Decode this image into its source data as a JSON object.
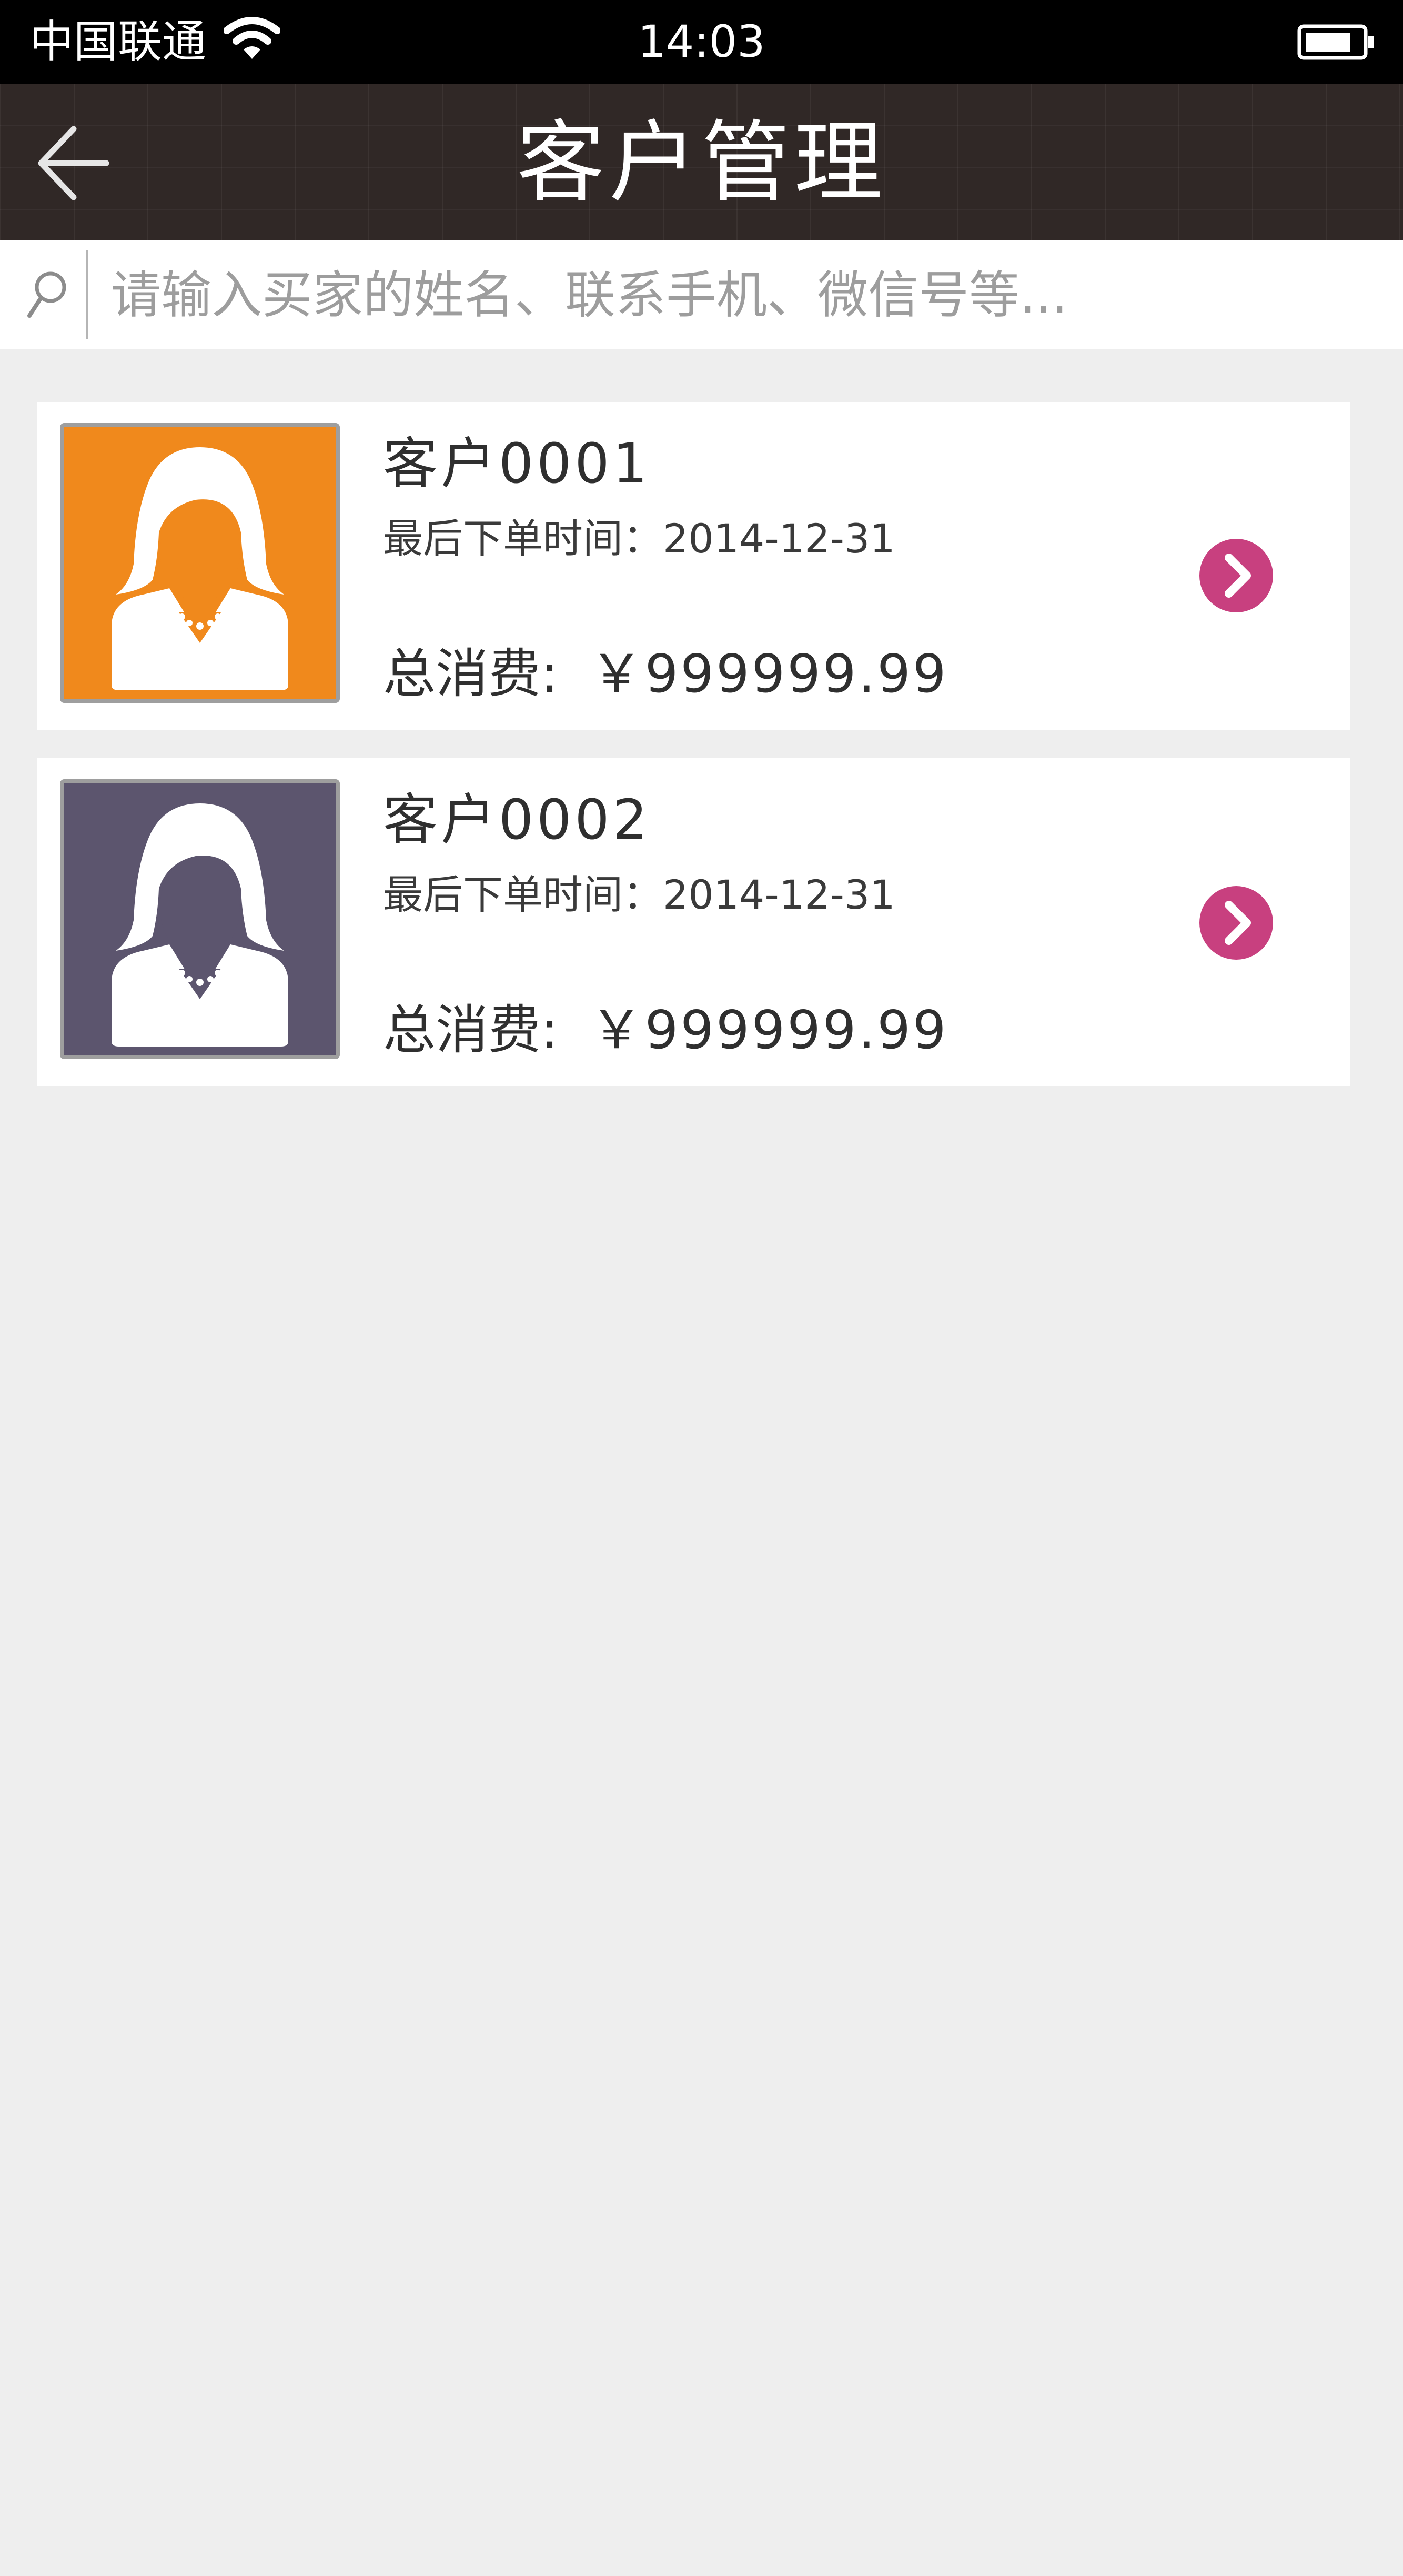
{
  "status_bar": {
    "carrier": "中国联通",
    "time": "14:03",
    "icons": [
      "wifi-icon",
      "battery-icon"
    ]
  },
  "nav": {
    "title": "客户管理",
    "back_icon": "arrow-left-icon"
  },
  "search": {
    "placeholder": "请输入买家的姓名、联系手机、微信号等...",
    "value": "",
    "icon": "search-icon"
  },
  "customers": [
    {
      "name": "客户0001",
      "last_order_label": "最后下单时间：",
      "last_order_date": "2014-12-31",
      "spend_label": "总消费:",
      "spend_value": "￥999999.99",
      "avatar_color": "#f0891c",
      "arrow_icon": "chevron-right-icon"
    },
    {
      "name": "客户0002",
      "last_order_label": "最后下单时间：",
      "last_order_date": "2014-12-31",
      "spend_label": "总消费:",
      "spend_value": "￥999999.99",
      "avatar_color": "#5c556e",
      "arrow_icon": "chevron-right-icon"
    }
  ],
  "colors": {
    "status_bar": "#000000",
    "nav_bar": "#302826",
    "accent_arrow": "#c8407f",
    "page_background": "#eeeeee"
  }
}
